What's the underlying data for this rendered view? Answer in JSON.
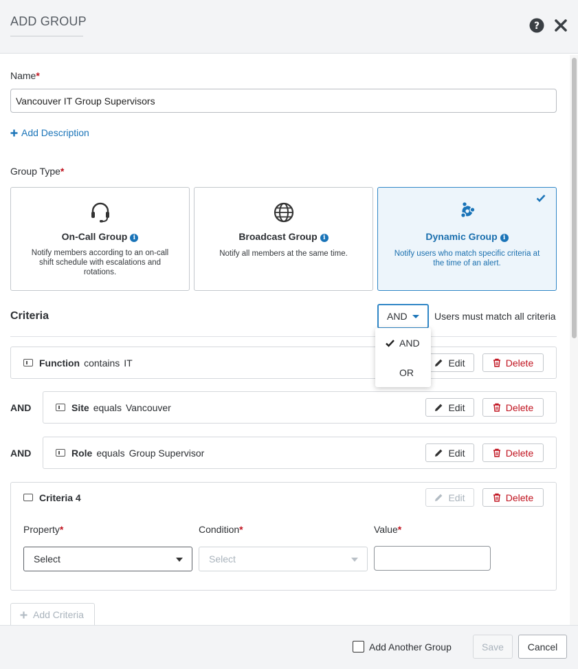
{
  "header": {
    "title": "ADD GROUP",
    "help_icon": "question-circle-icon",
    "close_icon": "close-icon"
  },
  "form": {
    "name_label": "Name",
    "required_mark": "*",
    "name_value": "Vancouver IT Group Supervisors",
    "add_description": "Add Description",
    "group_type_label": "Group Type"
  },
  "group_types": [
    {
      "title": "On-Call Group",
      "desc": "Notify members according to an on-call shift schedule with escalations and rotations.",
      "icon": "headset-icon",
      "selected": false
    },
    {
      "title": "Broadcast Group",
      "desc": "Notify all members at the same time.",
      "icon": "globe-icon",
      "selected": false
    },
    {
      "title": "Dynamic Group",
      "desc": "Notify users who match specific criteria at the time of an alert.",
      "icon": "dynamic-nodes-icon",
      "selected": true
    }
  ],
  "criteria": {
    "heading": "Criteria",
    "operator": "AND",
    "match_text": "Users must match all criteria",
    "and_word": "AND",
    "edit_label": "Edit",
    "delete_label": "Delete",
    "rows": [
      {
        "property": "Function",
        "condition": "contains",
        "value": "IT"
      },
      {
        "property": "Site",
        "condition": "equals",
        "value": "Vancouver"
      },
      {
        "property": "Role",
        "condition": "equals",
        "value": "Group Supervisor"
      }
    ],
    "new_row": {
      "title": "Criteria 4",
      "property_label": "Property",
      "condition_label": "Condition",
      "value_label": "Value",
      "property_select": "Select",
      "condition_select": "Select",
      "value_input": ""
    },
    "add_criteria": "Add Criteria"
  },
  "operator_dropdown": {
    "options": [
      "AND",
      "OR"
    ],
    "selected": "AND"
  },
  "footer": {
    "add_another": "Add Another Group",
    "save": "Save",
    "cancel": "Cancel"
  },
  "colors": {
    "accent": "#1a74b8",
    "danger": "#c0121e",
    "selected_bg": "#edf5fb"
  }
}
